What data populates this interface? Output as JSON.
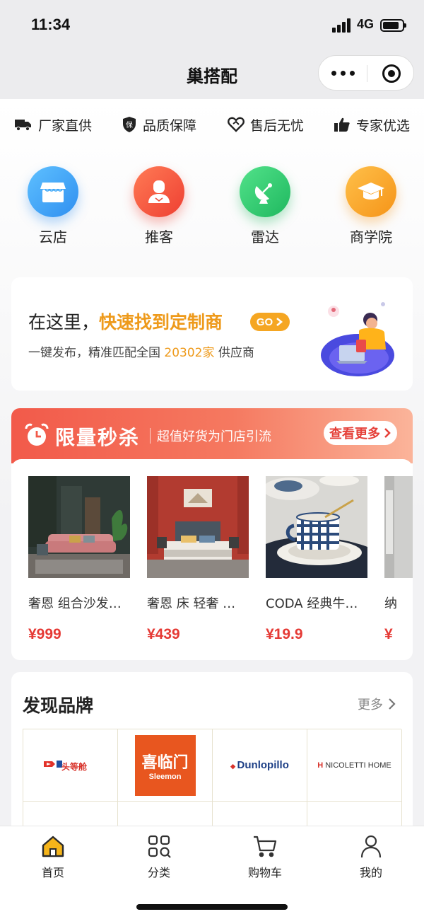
{
  "status_bar": {
    "time": "11:34",
    "network": "4G"
  },
  "nav": {
    "title": "巢搭配",
    "more_icon": "more-dots-icon",
    "close_icon": "target-icon"
  },
  "features": [
    {
      "label": "厂家直供",
      "icon": "truck-icon"
    },
    {
      "label": "品质保障",
      "icon": "shield-icon"
    },
    {
      "label": "售后无忧",
      "icon": "heart-handshake-icon"
    },
    {
      "label": "专家优选",
      "icon": "thumbs-up-icon"
    }
  ],
  "quick_links": [
    {
      "label": "云店",
      "icon": "store-icon",
      "color": "#3aa6f7"
    },
    {
      "label": "推客",
      "icon": "person-icon",
      "color": "#f4573e"
    },
    {
      "label": "雷达",
      "icon": "radar-dish-icon",
      "color": "#2fcf72"
    },
    {
      "label": "商学院",
      "icon": "graduation-cap-icon",
      "color": "#f7a022"
    }
  ],
  "banner": {
    "title_prefix": "在这里，",
    "title_highlight": "快速找到定制商",
    "go_label": "GO",
    "sub_prefix": "一键发布，精准匹配全国",
    "supplier_count": "20302家",
    "sub_suffix": "供应商"
  },
  "flash_sale": {
    "title": "限量秒杀",
    "subtitle": "超值好货为门店引流",
    "more_label": "查看更多",
    "products": [
      {
        "name": "奢恩 组合沙发…",
        "price": "¥999"
      },
      {
        "name": "奢恩 床 轻奢 …",
        "price": "¥439"
      },
      {
        "name": "CODA 经典牛…",
        "price": "¥19.9"
      },
      {
        "name": "纳",
        "price": "¥"
      }
    ]
  },
  "brands": {
    "title": "发现品牌",
    "more_label": "更多",
    "items": [
      "头等舱",
      "喜临门",
      "Sleemon",
      "Dunlopillo",
      "NICOLETTI HOME"
    ]
  },
  "tab_bar": [
    {
      "label": "首页",
      "icon": "home-icon",
      "active": true
    },
    {
      "label": "分类",
      "icon": "category-grid-icon",
      "active": false
    },
    {
      "label": "购物车",
      "icon": "cart-icon",
      "active": false
    },
    {
      "label": "我的",
      "icon": "user-icon",
      "active": false
    }
  ],
  "colors": {
    "accent_orange": "#ee9a1b",
    "sale_red": "#e53a35",
    "home_active": "#f5b41a"
  }
}
